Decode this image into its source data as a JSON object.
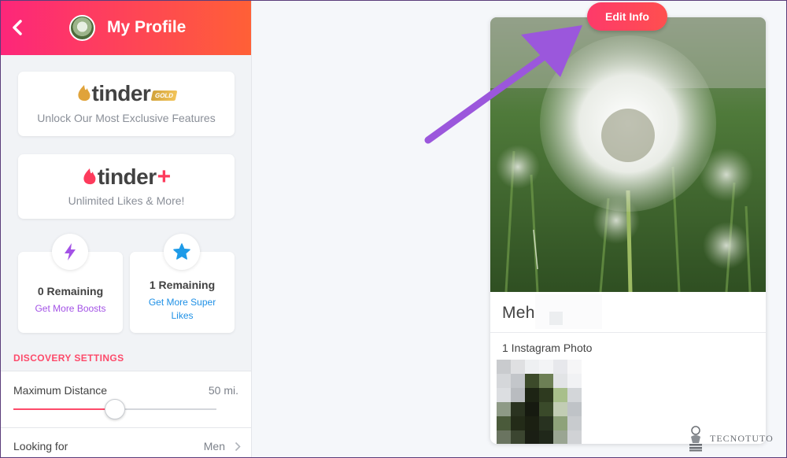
{
  "header": {
    "title": "My Profile",
    "back_icon": "chevron-left-icon",
    "gradient": [
      "#fd267a",
      "#ff6036"
    ]
  },
  "gold_card": {
    "logo_text": "tinder",
    "badge": "GOLD",
    "subtitle": "Unlock Our Most Exclusive Features",
    "flame_color": "#e0a33b"
  },
  "plus_card": {
    "logo_text": "tinder",
    "plus": "+",
    "subtitle": "Unlimited Likes & More!",
    "flame_color": "#fd3b5c"
  },
  "boosts": {
    "remaining": "0 Remaining",
    "link": "Get More Boosts",
    "icon": "lightning-bolt-icon",
    "color": "#a352e6"
  },
  "super_likes": {
    "remaining": "1 Remaining",
    "link": "Get More Super Likes",
    "icon": "star-icon",
    "color": "#1e90e6"
  },
  "discovery": {
    "section_title": "DISCOVERY SETTINGS",
    "max_distance": {
      "label": "Maximum Distance",
      "value": "50 mi.",
      "slider_fraction": 0.5
    },
    "looking_for": {
      "label": "Looking for",
      "value": "Men"
    }
  },
  "profile": {
    "edit_button": "Edit Info",
    "name": "Meh",
    "instagram_title": "1 Instagram Photo"
  },
  "watermark": "TECNOTUTO",
  "accent": "#fd4a6a"
}
